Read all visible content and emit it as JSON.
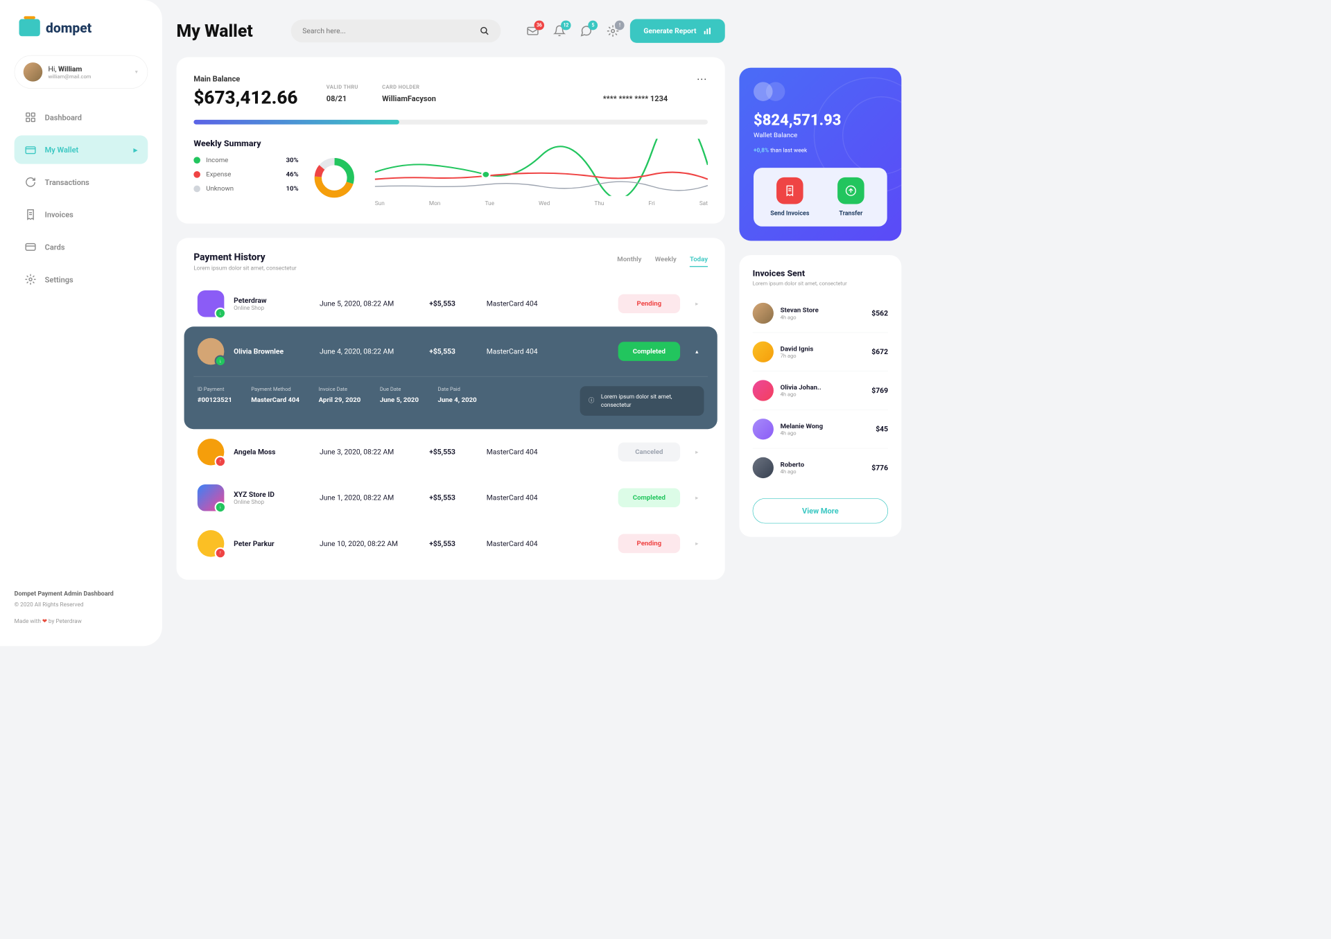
{
  "brand": "dompet",
  "user": {
    "greeting": "Hi, ",
    "name": "William",
    "email": "william@mail.com"
  },
  "nav": {
    "items": [
      {
        "label": "Dashboard"
      },
      {
        "label": "My Wallet",
        "active": true
      },
      {
        "label": "Transactions"
      },
      {
        "label": "Invoices"
      },
      {
        "label": "Cards"
      },
      {
        "label": "Settings"
      }
    ]
  },
  "footer": {
    "line1": "Dompet Payment Admin Dashboard",
    "line2": "© 2020 All Rights Reserved",
    "line3_a": "Made with ",
    "line3_b": " by Peterdraw"
  },
  "page_title": "My Wallet",
  "search": {
    "placeholder": "Search here..."
  },
  "notifications": {
    "mail": "36",
    "bell": "12",
    "chat": "5",
    "gear": "!"
  },
  "generate_report": "Generate Report",
  "balance": {
    "label": "Main Balance",
    "amount": "$673,412.66",
    "valid_thru_label": "VALID THRU",
    "valid_thru": "08/21",
    "holder_label": "CARD HOLDER",
    "holder": "WilliamFacyson",
    "card_number": "**** **** **** 1234"
  },
  "weekly": {
    "title": "Weekly Summary",
    "legend": [
      {
        "label": "Income",
        "value": "30%",
        "color": "#22c55e"
      },
      {
        "label": "Expense",
        "value": "46%",
        "color": "#ef4444"
      },
      {
        "label": "Unknown",
        "value": "10%",
        "color": "#d1d5db"
      }
    ],
    "days": [
      "Sun",
      "Mon",
      "Tue",
      "Wed",
      "Thu",
      "Fri",
      "Sat"
    ]
  },
  "chart_data": {
    "type": "line",
    "title": "Weekly Summary",
    "categories": [
      "Sun",
      "Mon",
      "Tue",
      "Wed",
      "Thu",
      "Fri",
      "Sat"
    ],
    "series": [
      {
        "name": "Income",
        "color": "#22c55e",
        "values": [
          45,
          60,
          40,
          75,
          30,
          80,
          55
        ]
      },
      {
        "name": "Expense",
        "color": "#ef4444",
        "values": [
          30,
          35,
          40,
          45,
          35,
          40,
          30
        ]
      },
      {
        "name": "Unknown",
        "color": "#9ca3af",
        "values": [
          20,
          22,
          20,
          24,
          20,
          22,
          20
        ]
      }
    ],
    "donut": [
      {
        "label": "Income",
        "value": 30,
        "color": "#22c55e"
      },
      {
        "label": "Expense",
        "value": 46,
        "color": "#f59e0b"
      },
      {
        "label": "Unknown",
        "value": 10,
        "color": "#ef4444"
      }
    ]
  },
  "wallet": {
    "amount": "$824,571.93",
    "label": "Wallet Balance",
    "change_strong": "+0,8%",
    "change_rest": " than last week",
    "actions": [
      {
        "label": "Send Invoices",
        "color": "#ef4444"
      },
      {
        "label": "Transfer",
        "color": "#22c55e"
      }
    ]
  },
  "payment_history": {
    "title": "Payment History",
    "subtitle": "Lorem ipsum dolor sit amet, consectetur",
    "tabs": [
      "Monthly",
      "Weekly",
      "Today"
    ],
    "active_tab": "Today",
    "rows": [
      {
        "merchant": "Peterdraw",
        "type": "Online Shop",
        "date": "June 5, 2020, 08:22 AM",
        "amount": "+$5,553",
        "method": "MasterCard 404",
        "status": "Pending",
        "status_class": "pending",
        "avatar_bg": "#8b5cf6",
        "badge_bg": "#22c55e"
      },
      {
        "merchant": "Olivia Brownlee",
        "type": "",
        "date": "June 4, 2020, 08:22 AM",
        "amount": "+$5,553",
        "method": "MasterCard 404",
        "status": "Completed",
        "status_class": "completed",
        "avatar_bg": "#d4a574",
        "badge_bg": "#22c55e",
        "expanded": true
      },
      {
        "merchant": "Angela Moss",
        "type": "",
        "date": "June 3, 2020, 08:22 AM",
        "amount": "+$5,553",
        "method": "MasterCard 404",
        "status": "Canceled",
        "status_class": "canceled",
        "avatar_bg": "#f59e0b",
        "badge_bg": "#ef4444"
      },
      {
        "merchant": "XYZ Store ID",
        "type": "Online Shop",
        "date": "June 1, 2020, 08:22 AM",
        "amount": "+$5,553",
        "method": "MasterCard 404",
        "status": "Completed",
        "status_class": "completed",
        "avatar_bg": "linear-gradient(135deg,#3b82f6,#ec4899)",
        "badge_bg": "#22c55e"
      },
      {
        "merchant": "Peter Parkur",
        "type": "",
        "date": "June 10, 2020, 08:22 AM",
        "amount": "+$5,553",
        "method": "MasterCard 404",
        "status": "Pending",
        "status_class": "pending",
        "avatar_bg": "#fbbf24",
        "badge_bg": "#ef4444"
      }
    ],
    "details": {
      "id_label": "ID Payment",
      "id": "#00123521",
      "method_label": "Payment Method",
      "method": "MasterCard 404",
      "invoice_label": "Invoice Date",
      "invoice": "April 29, 2020",
      "due_label": "Due Date",
      "due": "June 5, 2020",
      "paid_label": "Date Paid",
      "paid": "June 4, 2020",
      "info": "Lorem ipsum dolor sit amet, consectetur"
    }
  },
  "invoices": {
    "title": "Invoices Sent",
    "subtitle": "Lorem ipsum dolor sit amet, consectetur",
    "rows": [
      {
        "name": "Stevan Store",
        "time": "4h ago",
        "amount": "$562"
      },
      {
        "name": "David Ignis",
        "time": "7h ago",
        "amount": "$672"
      },
      {
        "name": "Olivia Johan..",
        "time": "4h ago",
        "amount": "$769"
      },
      {
        "name": "Melanie Wong",
        "time": "4h ago",
        "amount": "$45"
      },
      {
        "name": "Roberto",
        "time": "4h ago",
        "amount": "$776"
      }
    ],
    "view_more": "View More"
  }
}
